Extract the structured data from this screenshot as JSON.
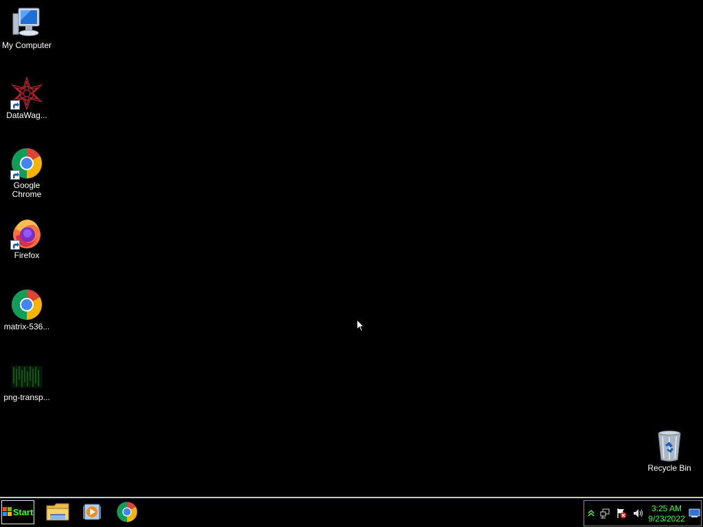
{
  "desktop": {
    "icons": [
      {
        "label": "My Computer",
        "icon": "computer-icon"
      },
      {
        "label": "DataWag...",
        "icon": "datawag-icon",
        "shortcut": true
      },
      {
        "label": "Google\nChrome",
        "icon": "chrome-icon",
        "shortcut": true
      },
      {
        "label": "Firefox",
        "icon": "firefox-icon",
        "shortcut": true
      },
      {
        "label": "matrix-536...",
        "icon": "chrome-icon"
      },
      {
        "label": "png-transp...",
        "icon": "matrix-image-icon"
      },
      {
        "label": "Recycle Bin",
        "icon": "recycle-bin-icon"
      }
    ]
  },
  "taskbar": {
    "start_label": "Start",
    "pinned": [
      {
        "name": "file-explorer",
        "icon": "folder-icon"
      },
      {
        "name": "media-player",
        "icon": "media-player-icon"
      },
      {
        "name": "chrome",
        "icon": "chrome-icon"
      }
    ],
    "tray": {
      "icons": [
        "show-hidden-icons-icon",
        "network-icon",
        "action-center-flag-icon",
        "volume-icon"
      ],
      "time": "3:25 AM",
      "date": "9/23/2022",
      "show_desktop_icon": "show-desktop-icon"
    }
  },
  "colors": {
    "desktop_bg": "#000000",
    "taskbar_bg": "#000000",
    "taskbar_border": "#c7c7ff",
    "accent_text": "#39ff3a"
  }
}
